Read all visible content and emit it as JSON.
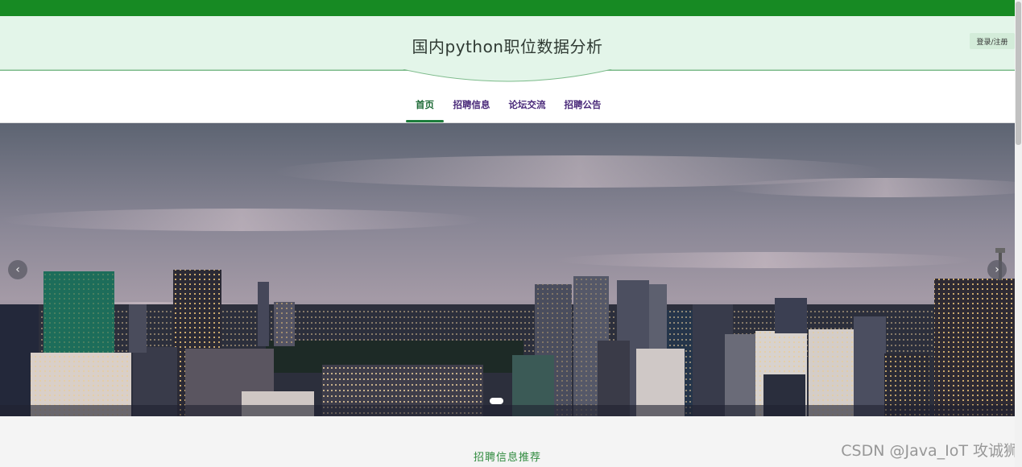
{
  "header": {
    "title": "国内python职位数据分析",
    "login_label": "登录/注册"
  },
  "nav": {
    "items": [
      {
        "label": "首页",
        "active": true
      },
      {
        "label": "招聘信息",
        "active": false
      },
      {
        "label": "论坛交流",
        "active": false
      },
      {
        "label": "招聘公告",
        "active": false
      }
    ]
  },
  "carousel": {
    "prev_icon": "chevron-left-icon",
    "next_icon": "chevron-right-icon",
    "prev_glyph": "‹",
    "next_glyph": "›",
    "slide_count": 1,
    "active_slide": 1,
    "slide_description_icon": "city-skyline-image"
  },
  "section": {
    "title": "招聘信息推荐"
  },
  "watermark": "CSDN @Java_IoT 攻诚狮",
  "colors": {
    "brand_green": "#178a23",
    "header_bg": "#e3f5e9",
    "nav_text": "#4a2a7a",
    "section_title": "#2f8a3e"
  }
}
